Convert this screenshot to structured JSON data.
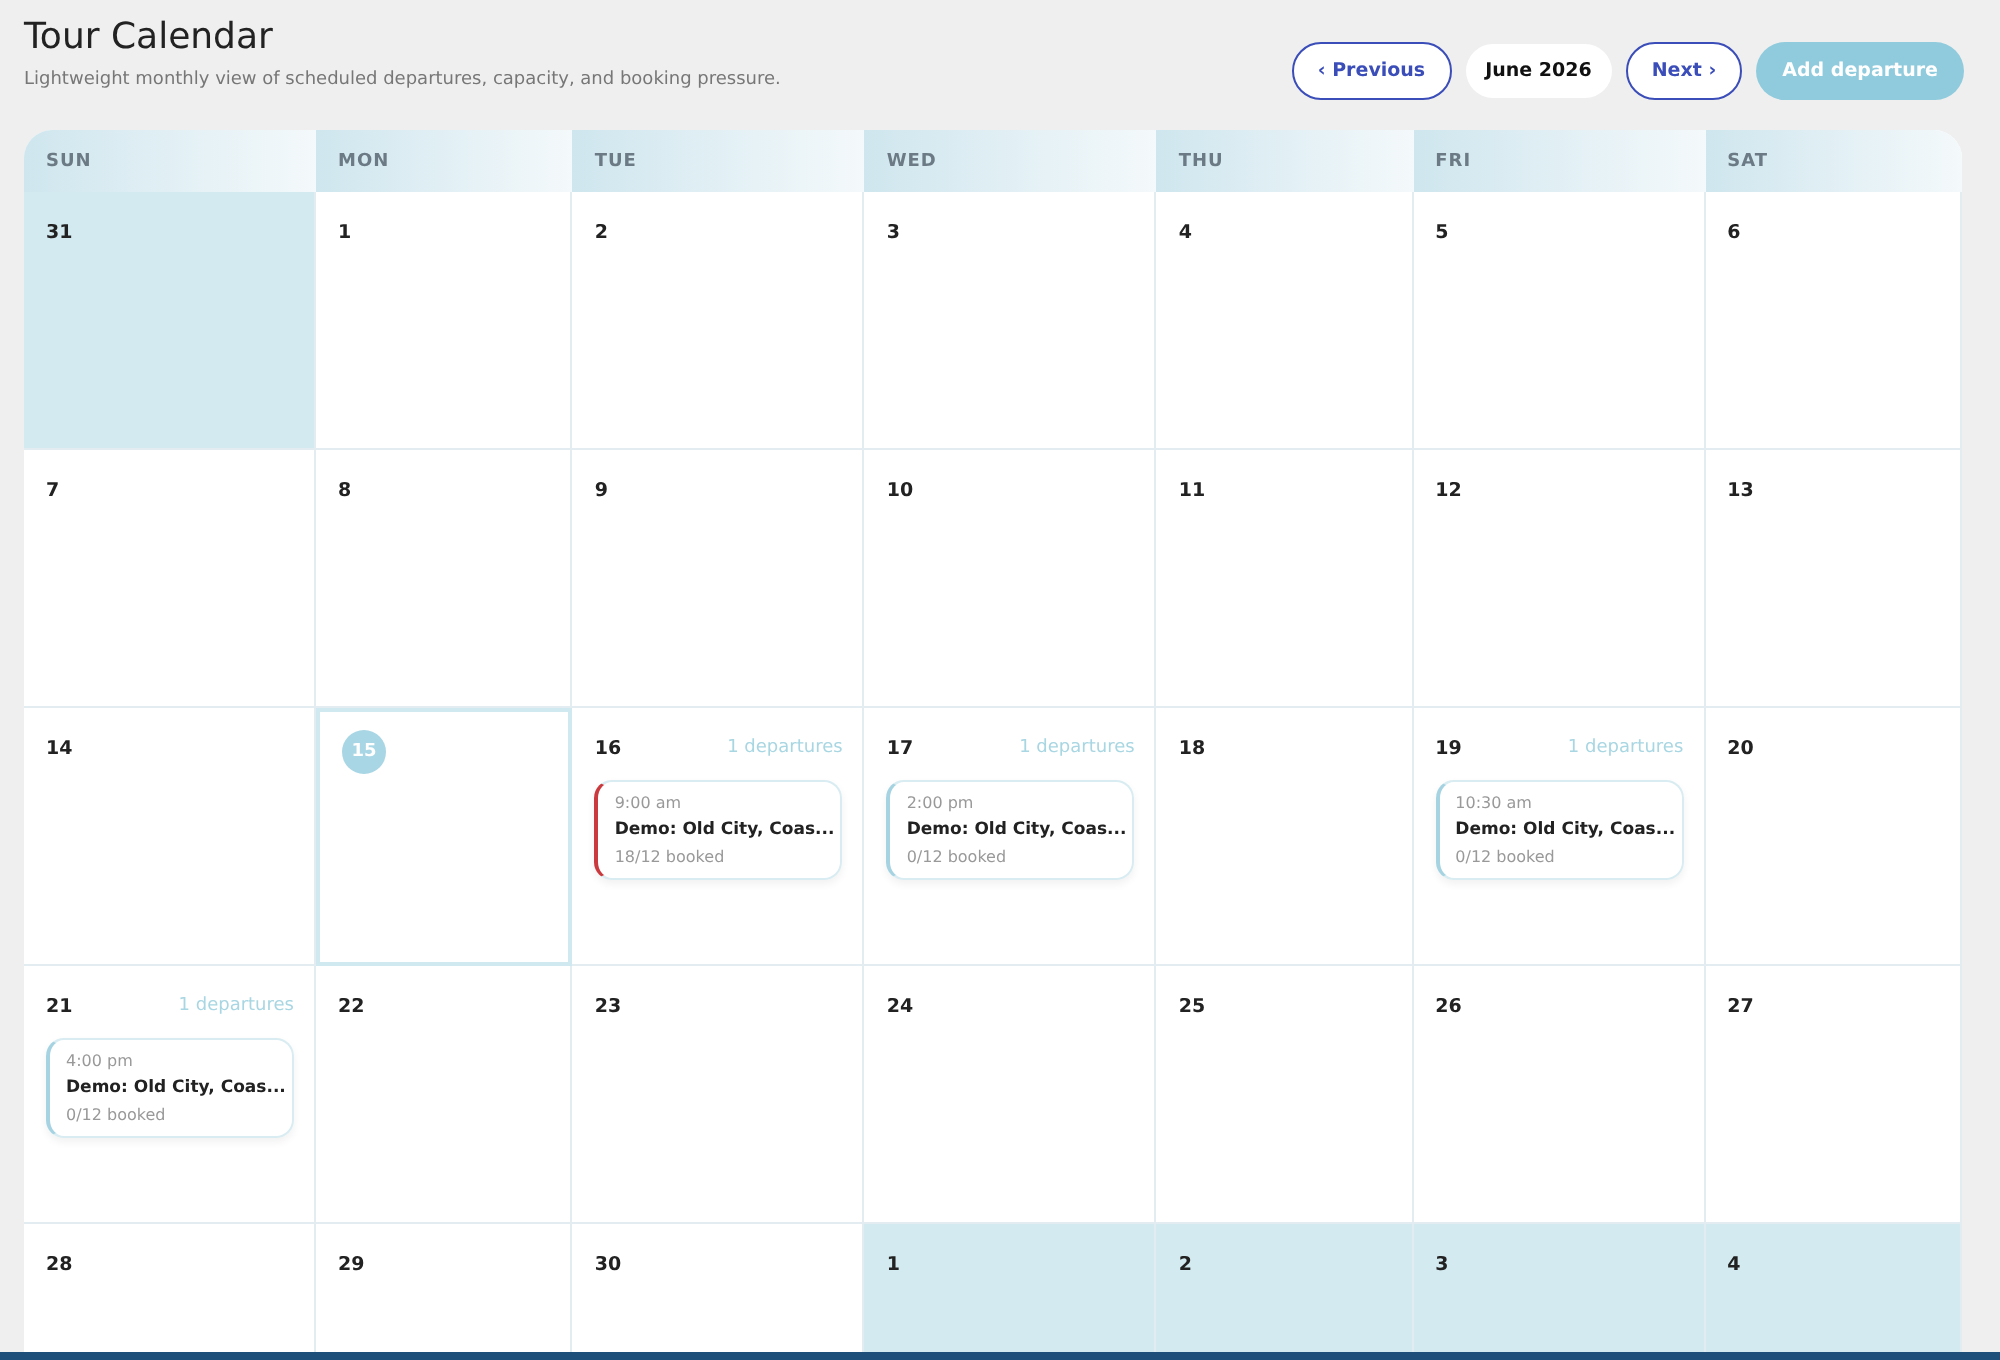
{
  "title": "Tour Calendar",
  "subtitle": "Lightweight monthly view of scheduled departures, capacity, and booking pressure.",
  "nav": {
    "previous": "‹ Previous",
    "month": "June 2026",
    "next": "Next ›",
    "add": "Add departure"
  },
  "weekdays": [
    "SUN",
    "MON",
    "TUE",
    "WED",
    "THU",
    "FRI",
    "SAT"
  ],
  "days": [
    {
      "number": "31",
      "outside": true,
      "today": false
    },
    {
      "number": "1",
      "outside": false,
      "today": false
    },
    {
      "number": "2",
      "outside": false,
      "today": false
    },
    {
      "number": "3",
      "outside": false,
      "today": false
    },
    {
      "number": "4",
      "outside": false,
      "today": false
    },
    {
      "number": "5",
      "outside": false,
      "today": false
    },
    {
      "number": "6",
      "outside": false,
      "today": false
    },
    {
      "number": "7",
      "outside": false,
      "today": false
    },
    {
      "number": "8",
      "outside": false,
      "today": false
    },
    {
      "number": "9",
      "outside": false,
      "today": false
    },
    {
      "number": "10",
      "outside": false,
      "today": false
    },
    {
      "number": "11",
      "outside": false,
      "today": false
    },
    {
      "number": "12",
      "outside": false,
      "today": false
    },
    {
      "number": "13",
      "outside": false,
      "today": false
    },
    {
      "number": "14",
      "outside": false,
      "today": false
    },
    {
      "number": "15",
      "outside": false,
      "today": true
    },
    {
      "number": "16",
      "outside": false,
      "today": false,
      "count": "1 departures",
      "events": [
        {
          "time": "9:00 am",
          "title": "Demo: Old City, Coas...",
          "booked": "18/12 booked",
          "overbooked": true
        }
      ]
    },
    {
      "number": "17",
      "outside": false,
      "today": false,
      "count": "1 departures",
      "events": [
        {
          "time": "2:00 pm",
          "title": "Demo: Old City, Coas...",
          "booked": "0/12 booked",
          "overbooked": false
        }
      ]
    },
    {
      "number": "18",
      "outside": false,
      "today": false
    },
    {
      "number": "19",
      "outside": false,
      "today": false,
      "count": "1 departures",
      "events": [
        {
          "time": "10:30 am",
          "title": "Demo: Old City, Coas...",
          "booked": "0/12 booked",
          "overbooked": false
        }
      ]
    },
    {
      "number": "20",
      "outside": false,
      "today": false
    },
    {
      "number": "21",
      "outside": false,
      "today": false,
      "count": "1 departures",
      "events": [
        {
          "time": "4:00 pm",
          "title": "Demo: Old City, Coas...",
          "booked": "0/12 booked",
          "overbooked": false
        }
      ]
    },
    {
      "number": "22",
      "outside": false,
      "today": false
    },
    {
      "number": "23",
      "outside": false,
      "today": false
    },
    {
      "number": "24",
      "outside": false,
      "today": false
    },
    {
      "number": "25",
      "outside": false,
      "today": false
    },
    {
      "number": "26",
      "outside": false,
      "today": false
    },
    {
      "number": "27",
      "outside": false,
      "today": false
    },
    {
      "number": "28",
      "outside": false,
      "today": false
    },
    {
      "number": "29",
      "outside": false,
      "today": false
    },
    {
      "number": "30",
      "outside": false,
      "today": false
    },
    {
      "number": "1",
      "outside": true,
      "today": false
    },
    {
      "number": "2",
      "outside": true,
      "today": false
    },
    {
      "number": "3",
      "outside": true,
      "today": false
    },
    {
      "number": "4",
      "outside": true,
      "today": false
    }
  ]
}
